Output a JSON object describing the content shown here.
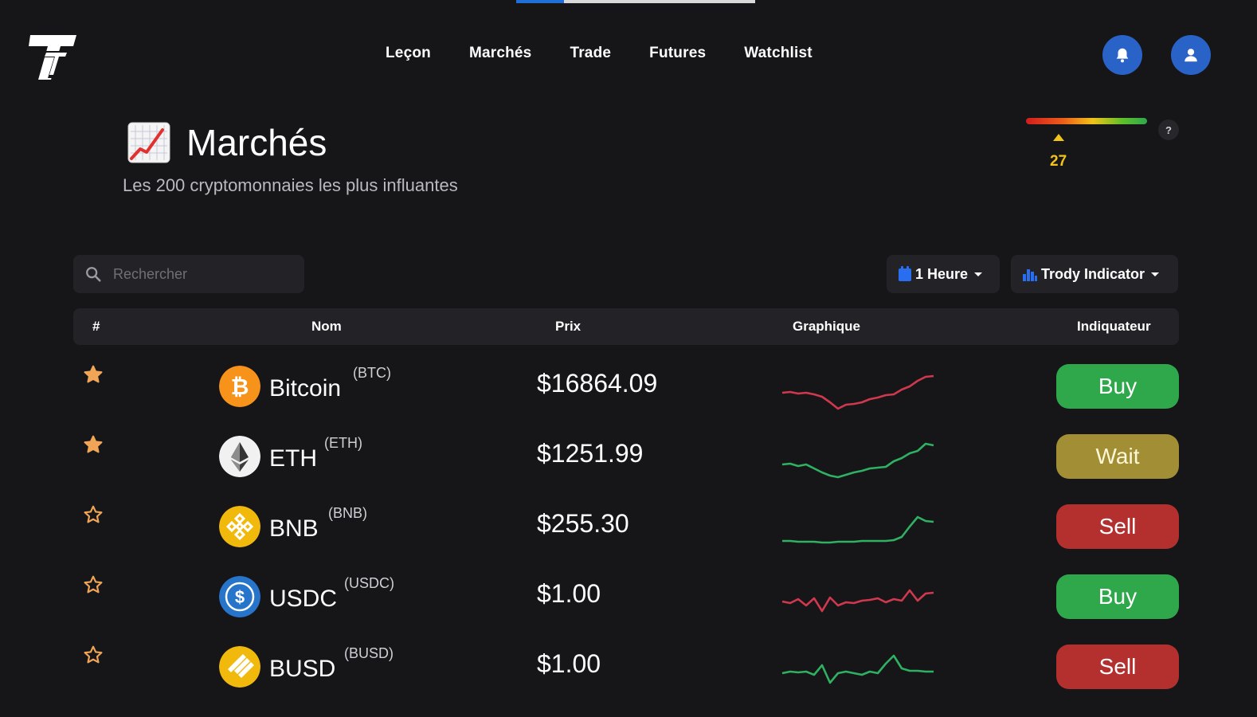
{
  "top_progress_fraction": 0.2,
  "logo": {
    "letters": "TT"
  },
  "nav": {
    "items": [
      "Leçon",
      "Marchés",
      "Trade",
      "Futures",
      "Watchlist"
    ]
  },
  "header_icons": [
    "bell-icon",
    "user-icon"
  ],
  "page": {
    "title_icon": "chart-increasing-icon",
    "title": "Marchés",
    "subtitle": "Les 200 cryptomonnaies les plus influantes"
  },
  "sentiment_gauge": {
    "value": 27,
    "value_label": "27",
    "scale_min": 0,
    "scale_max": 100,
    "help_label": "?",
    "colors": [
      "#d21d1d",
      "#f2c318",
      "#2fa84c"
    ]
  },
  "search": {
    "placeholder": "Rechercher",
    "value": ""
  },
  "filters": {
    "timeframe": {
      "label": "1 Heure",
      "icon": "calendar-icon"
    },
    "indicator": {
      "label": "Trody Indicator",
      "icon": "bar-chart-icon"
    }
  },
  "table": {
    "headers": {
      "rank": "#",
      "name": "Nom",
      "price": "Prix",
      "chart": "Graphique",
      "indicator": "Indiquateur"
    },
    "rows": [
      {
        "favorite": true,
        "name": "Bitcoin",
        "symbol": "(BTC)",
        "price": "$16864.09",
        "signal": "Buy",
        "icon": "bitcoin-icon",
        "trend_color": "#d0384e",
        "spark": [
          50,
          49,
          51,
          50,
          52,
          55,
          62,
          70,
          65,
          64,
          62,
          58,
          56,
          53,
          52,
          46,
          42,
          35,
          30,
          29
        ]
      },
      {
        "favorite": true,
        "name": "ETH",
        "symbol": "(ETH)",
        "price": "$1251.99",
        "signal": "Wait",
        "icon": "ethereum-icon",
        "trend_color": "#2fb062",
        "spark": [
          52,
          51,
          54,
          52,
          57,
          62,
          66,
          68,
          65,
          62,
          60,
          57,
          56,
          55,
          48,
          44,
          38,
          35,
          26,
          28
        ]
      },
      {
        "favorite": false,
        "name": "BNB",
        "symbol": "(BNB)",
        "price": "$255.30",
        "signal": "Sell",
        "icon": "bnb-icon",
        "trend_color": "#2fb062",
        "spark": [
          60,
          60,
          61,
          61,
          61,
          62,
          62,
          61,
          61,
          61,
          60,
          60,
          60,
          60,
          59,
          55,
          42,
          30,
          35,
          36
        ]
      },
      {
        "favorite": false,
        "name": "USDC",
        "symbol": "(USDC)",
        "price": "$1.00",
        "signal": "Buy",
        "icon": "usdc-icon",
        "trend_color": "#d0384e",
        "spark": [
          48,
          50,
          45,
          53,
          44,
          60,
          43,
          53,
          49,
          50,
          47,
          46,
          44,
          49,
          45,
          47,
          34,
          47,
          38,
          37
        ]
      },
      {
        "favorite": false,
        "name": "BUSD",
        "symbol": "(BUSD)",
        "price": "$1.00",
        "signal": "Sell",
        "icon": "busd-icon",
        "trend_color": "#2fb062",
        "spark": [
          50,
          48,
          49,
          48,
          52,
          40,
          62,
          50,
          48,
          50,
          52,
          48,
          50,
          38,
          28,
          44,
          47,
          47,
          48,
          48
        ]
      }
    ]
  },
  "signal_colors": {
    "Buy": "#2ea84a",
    "Wait": "#a28e34",
    "Sell": "#b4302f"
  },
  "star_color": "#f0a557"
}
